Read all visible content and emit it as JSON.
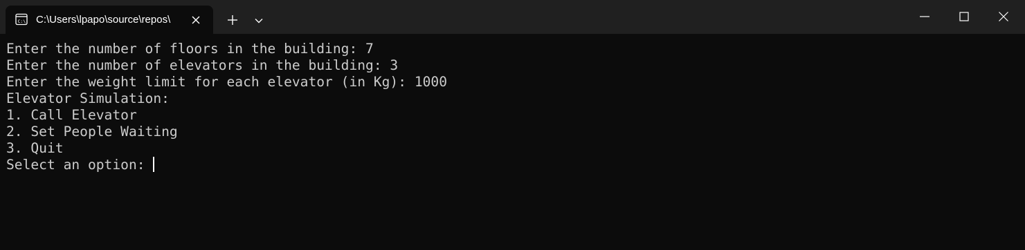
{
  "window": {
    "tab_title": "C:\\Users\\lpapo\\source\\repos\\",
    "tab_icon": "terminal-icon"
  },
  "terminal": {
    "lines": [
      "Enter the number of floors in the building: 7",
      "Enter the number of elevators in the building: 3",
      "Enter the weight limit for each elevator (in Kg): 1000",
      "Elevator Simulation:",
      "1. Call Elevator",
      "2. Set People Waiting",
      "3. Quit"
    ],
    "prompt": "Select an option: "
  },
  "colors": {
    "titlebar": "#202020",
    "background": "#0c0c0c",
    "text": "#cccccc"
  }
}
